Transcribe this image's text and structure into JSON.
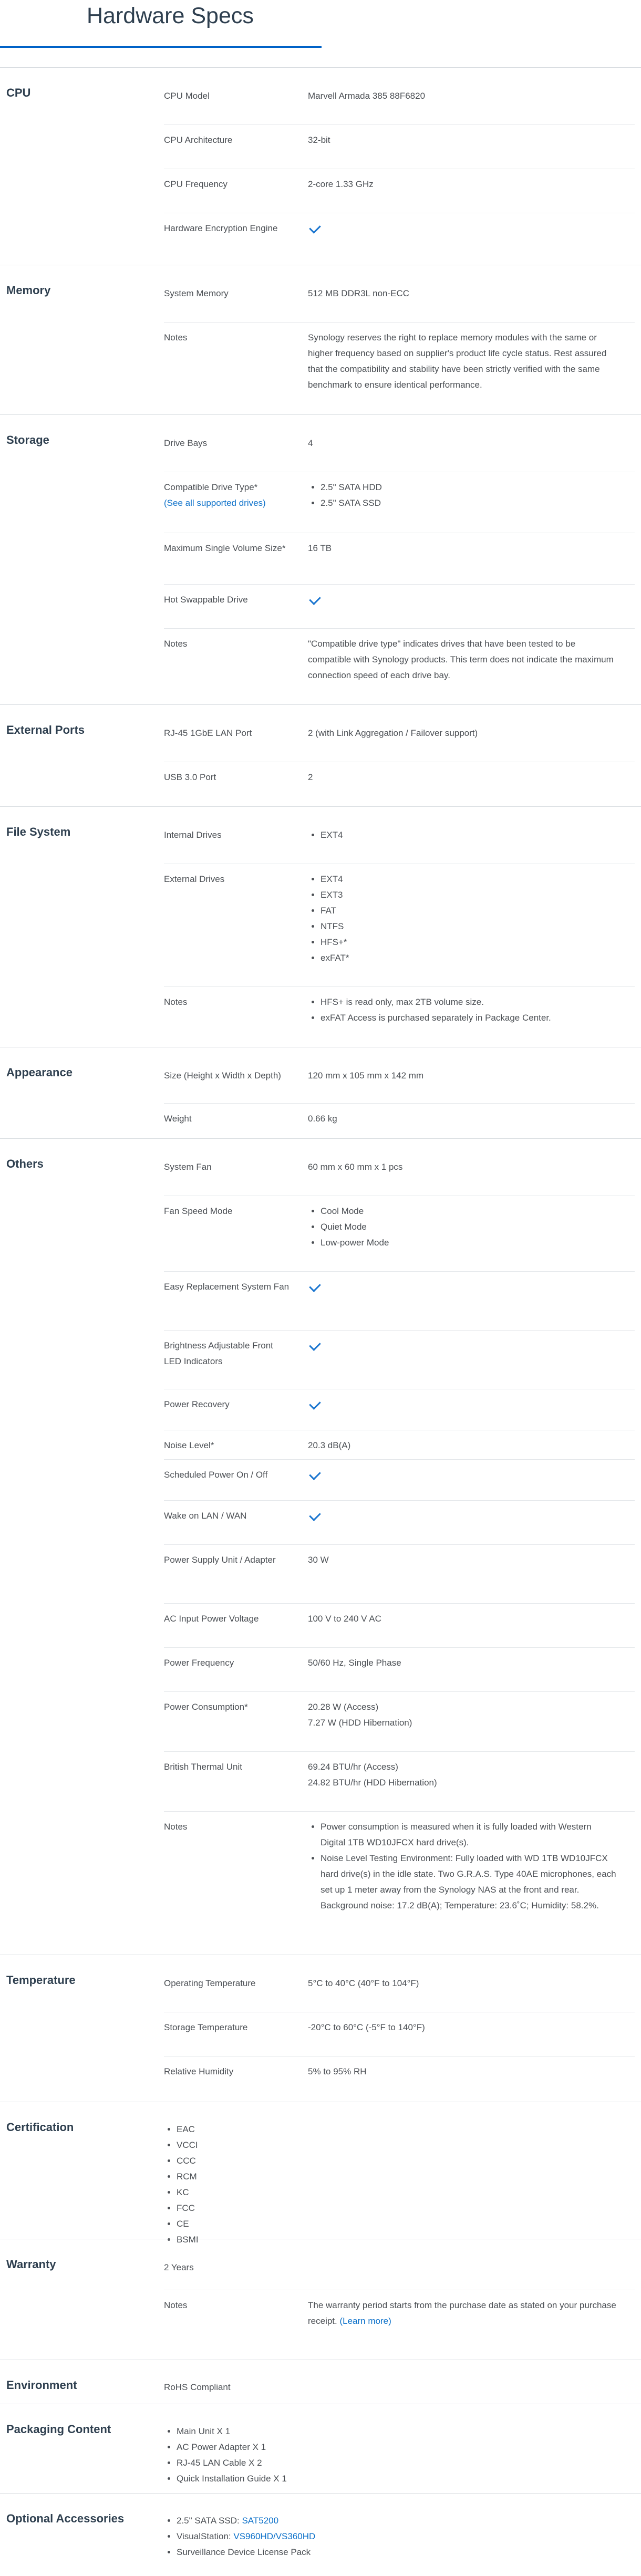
{
  "page": {
    "title": "Hardware Specs"
  },
  "check_icon": "check-icon",
  "accent_color": "#0062c7",
  "sections": {
    "cpu": {
      "name": "CPU",
      "rows": [
        {
          "label": "CPU Model",
          "value": "Marvell Armada 385 88F6820"
        },
        {
          "label": "CPU Architecture",
          "value": "32-bit"
        },
        {
          "label": "CPU Frequency",
          "value": "2-core 1.33 GHz"
        },
        {
          "label": "Hardware Encryption Engine",
          "value": "check"
        }
      ]
    },
    "memory": {
      "name": "Memory",
      "rows": [
        {
          "label": "System Memory",
          "value": "512 MB DDR3L non-ECC"
        },
        {
          "label": "Notes",
          "value": "Synology reserves the right to replace memory modules with the same or higher frequency based on supplier's product life cycle status. Rest assured that the compatibility and stability have been strictly verified with the same benchmark to ensure identical performance."
        }
      ]
    },
    "storage": {
      "name": "Storage",
      "rows": [
        {
          "label": "Drive Bays",
          "value": "4"
        },
        {
          "label": "Compatible Drive Type*",
          "link": "(See all supported drives)",
          "items": [
            "2.5\" SATA HDD",
            "2.5\" SATA SSD"
          ]
        },
        {
          "label": "Maximum Single Volume Size*",
          "value": "16 TB"
        },
        {
          "label": "Hot Swappable Drive",
          "value": "check"
        },
        {
          "label": "Notes",
          "value": "\"Compatible drive type\" indicates drives that have been tested to be compatible with Synology products. This term does not indicate the maximum connection speed of each drive bay."
        }
      ]
    },
    "ports": {
      "name": "External Ports",
      "rows": [
        {
          "label": "RJ-45 1GbE LAN Port",
          "value": "2 (with Link Aggregation / Failover support)"
        },
        {
          "label": "USB 3.0 Port",
          "value": "2"
        }
      ]
    },
    "filesystem": {
      "name": "File System",
      "rows": [
        {
          "label": "Internal Drives",
          "items": [
            "EXT4"
          ]
        },
        {
          "label": "External Drives",
          "items": [
            "EXT4",
            "EXT3",
            "FAT",
            "NTFS",
            "HFS+*",
            "exFAT*"
          ]
        },
        {
          "label": "Notes",
          "items": [
            "HFS+ is read only, max 2TB volume size.",
            "exFAT Access is purchased separately in Package Center."
          ]
        }
      ]
    },
    "appearance": {
      "name": "Appearance",
      "rows": [
        {
          "label": "Size (Height x Width x Depth)",
          "value": "120 mm x 105 mm x 142 mm"
        },
        {
          "label": "Weight",
          "value": "0.66 kg"
        }
      ]
    },
    "others": {
      "name": "Others",
      "rows": [
        {
          "label": "System Fan",
          "value": "60 mm x 60 mm x 1 pcs"
        },
        {
          "label": "Fan Speed Mode",
          "items": [
            "Cool Mode",
            "Quiet Mode",
            "Low-power Mode"
          ]
        },
        {
          "label": "Easy Replacement System Fan",
          "value": "check"
        },
        {
          "label": "Brightness Adjustable Front LED Indicators",
          "value": "check"
        },
        {
          "label": "Power Recovery",
          "value": "check"
        },
        {
          "label": "Noise Level*",
          "value": "20.3 dB(A)"
        },
        {
          "label": "Scheduled Power On / Off",
          "value": "check"
        },
        {
          "label": "Wake on LAN / WAN",
          "value": "check"
        },
        {
          "label": "Power Supply Unit / Adapter",
          "value": "30 W"
        },
        {
          "label": "AC Input Power Voltage",
          "value": "100 V to 240 V AC"
        },
        {
          "label": "Power Frequency",
          "value": "50/60 Hz, Single Phase"
        },
        {
          "label": "Power Consumption*",
          "lines": [
            "20.28 W (Access)",
            "7.27 W (HDD Hibernation)"
          ]
        },
        {
          "label": "British Thermal Unit",
          "lines": [
            "69.24 BTU/hr (Access)",
            "24.82 BTU/hr (HDD Hibernation)"
          ]
        },
        {
          "label": "Notes",
          "items": [
            "Power consumption is measured when it is fully loaded with Western Digital 1TB WD10JFCX hard drive(s).",
            "Noise Level Testing Environment: Fully loaded with WD 1TB WD10JFCX hard drive(s) in the idle state. Two G.R.A.S. Type 40AE microphones, each set up 1 meter away from the Synology NAS at the front and rear. Background noise: 17.2 dB(A); Temperature: 23.6˚C; Humidity: 58.2%."
          ]
        }
      ]
    },
    "temperature": {
      "name": "Temperature",
      "rows": [
        {
          "label": "Operating Temperature",
          "value": "5°C to 40°C (40°F to 104°F)"
        },
        {
          "label": "Storage Temperature",
          "value": "-20°C to 60°C (-5°F to 140°F)"
        },
        {
          "label": "Relative Humidity",
          "value": "5% to 95% RH"
        }
      ]
    },
    "certification": {
      "name": "Certification",
      "items": [
        "EAC",
        "VCCI",
        "CCC",
        "RCM",
        "KC",
        "FCC",
        "CE",
        "BSMI"
      ]
    },
    "warranty": {
      "name": "Warranty",
      "value": "2 Years",
      "notes_label": "Notes",
      "notes_text": "The warranty period starts from the purchase date as stated on your purchase receipt.",
      "notes_link": "(Learn more)"
    },
    "environment": {
      "name": "Environment",
      "value": "RoHS Compliant"
    },
    "packaging": {
      "name": "Packaging Content",
      "items": [
        "Main Unit X 1",
        "AC Power Adapter X 1",
        "RJ-45 LAN Cable X 2",
        "Quick Installation Guide X 1"
      ]
    },
    "accessories": {
      "name": "Optional Accessories",
      "item1_prefix": "2.5\" SATA SSD: ",
      "item1_link": "SAT5200",
      "item2_prefix": "VisualStation: ",
      "item2_link": "VS960HD/VS360HD",
      "item3": "Surveillance Device License Pack"
    }
  }
}
